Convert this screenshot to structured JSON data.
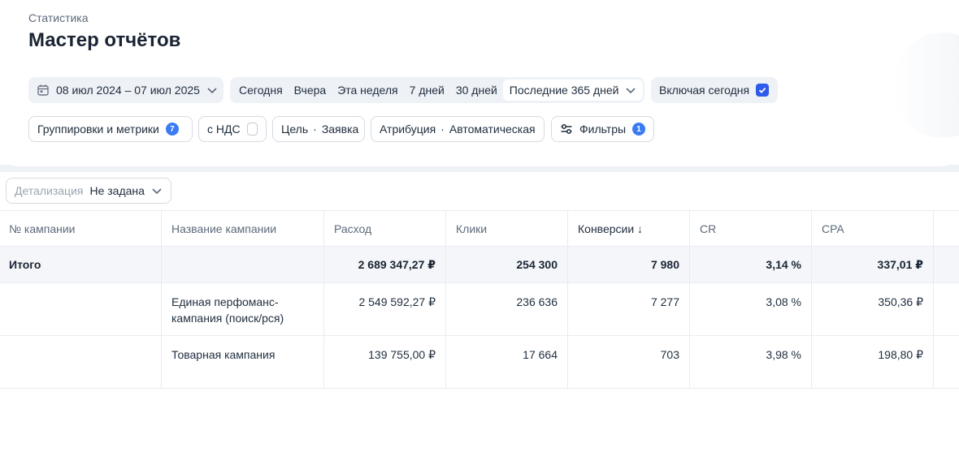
{
  "breadcrumb": "Статистика",
  "title": "Мастер отчётов",
  "date_range": {
    "value": "08 июл 2024 – 07 июл 2025",
    "icon": "calendar-icon"
  },
  "periods": {
    "today": "Сегодня",
    "yesterday": "Вчера",
    "this_week": "Эта неделя",
    "days7": "7 дней",
    "days30": "30 дней",
    "days365": "Последние 365 дней"
  },
  "include_today": {
    "label": "Включая сегодня",
    "checked": true
  },
  "controls": {
    "grouping_label": "Группировки и метрики",
    "grouping_count": "7",
    "vat_label": "с НДС",
    "goal_label": "Цель",
    "goal_value": "Заявка",
    "attribution_label": "Атрибуция",
    "attribution_value": "Автоматическая",
    "filters_label": "Фильтры",
    "filters_count": "1",
    "separator": "·"
  },
  "detail": {
    "label": "Детализация",
    "value": "Не задана"
  },
  "table": {
    "headers": [
      "№ кампании",
      "Название кампании",
      "Расход",
      "Клики",
      "Конверсии ↓",
      "CR",
      "CPA"
    ],
    "total": {
      "label": "Итого",
      "spend": "2 689 347,27 ₽",
      "clicks": "254 300",
      "conversions": "7 980",
      "cr": "3,14 %",
      "cpa": "337,01 ₽"
    },
    "rows": [
      {
        "id": "",
        "name": "Единая перфоманс-кампания (поиск/рся)",
        "spend": "2 549 592,27 ₽",
        "clicks": "236 636",
        "conversions": "7 277",
        "cr": "3,08 %",
        "cpa": "350,36 ₽"
      },
      {
        "id": "",
        "name": "Товарная кампания",
        "spend": "139 755,00 ₽",
        "clicks": "17 664",
        "conversions": "703",
        "cr": "3,98 %",
        "cpa": "198,80 ₽"
      }
    ]
  },
  "colors": {
    "accent": "#2f5bea",
    "badge": "#3b7bf2",
    "panel_bg": "#eef1f6"
  }
}
